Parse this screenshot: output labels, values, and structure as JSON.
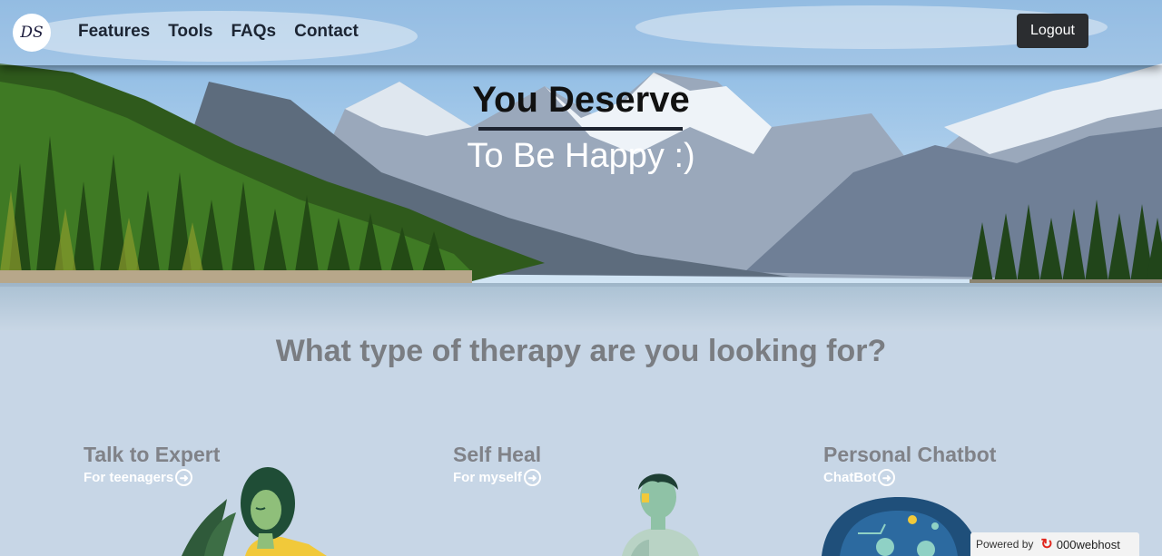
{
  "logo": {
    "text": "DS"
  },
  "nav": {
    "links": [
      {
        "label": "Features"
      },
      {
        "label": "Tools"
      },
      {
        "label": "FAQs"
      },
      {
        "label": "Contact"
      }
    ],
    "logout_label": "Logout"
  },
  "hero": {
    "headline": "You Deserve",
    "subhead": "To Be Happy :)"
  },
  "section": {
    "question": "What type of therapy are you looking for?",
    "cards": [
      {
        "title": "Talk to Expert",
        "subtitle": "For teenagers",
        "icon": "arrow-right-circle-icon"
      },
      {
        "title": "Self Heal",
        "subtitle": "For myself",
        "icon": "arrow-right-circle-icon"
      },
      {
        "title": "Personal Chatbot",
        "subtitle": "ChatBot",
        "icon": "arrow-right-circle-icon"
      }
    ]
  },
  "footer_badge": {
    "prefix": "Powered by",
    "brand": "000webhost"
  },
  "colors": {
    "sky": "#9cc3e6",
    "lake": "#c9d7e3",
    "forest": "#2f5a1c",
    "logout_bg": "#2b2d30",
    "question_text": "#7a7d82",
    "card_title": "#808288"
  }
}
